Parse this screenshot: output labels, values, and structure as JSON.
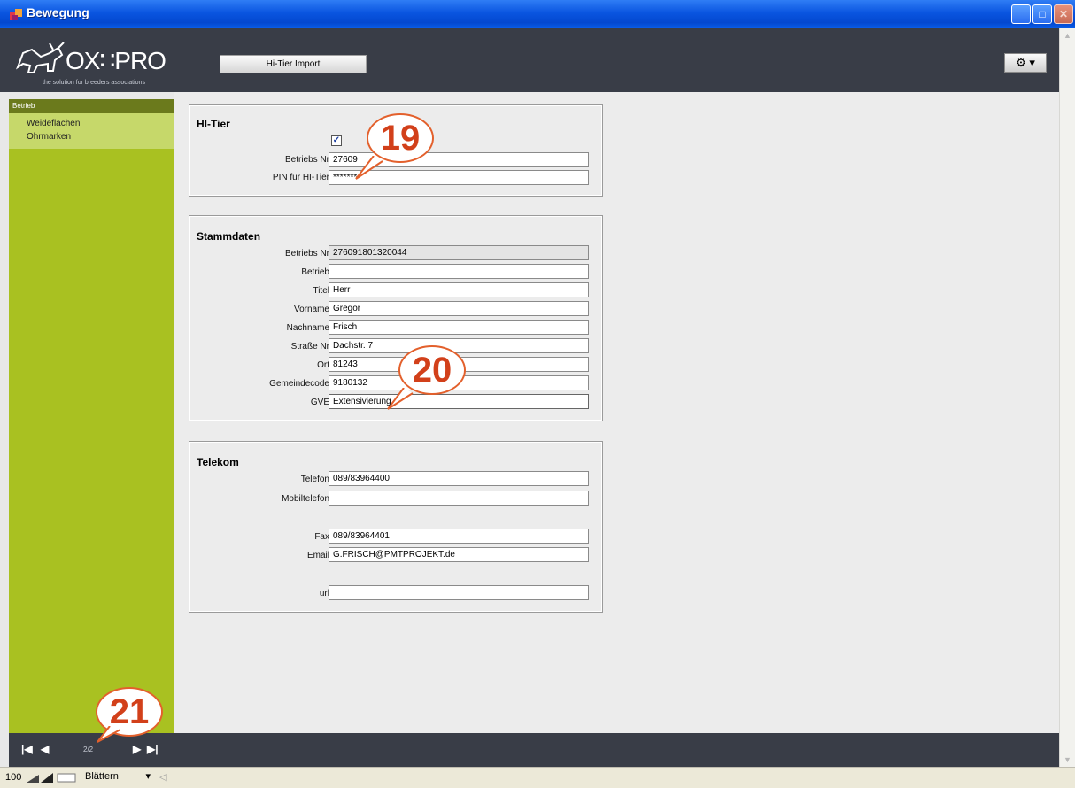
{
  "window": {
    "title": "Bewegung"
  },
  "header": {
    "logo_text": "OX∷PRO",
    "logo_sub": "the solution for breeders associations",
    "import_button": "Hi-Tier Import",
    "gear_label": "⚙ ▾"
  },
  "sidebar": {
    "header": "Betrieb",
    "items": [
      {
        "label": "Weideflächen"
      },
      {
        "label": "Ohrmarken"
      }
    ]
  },
  "hitier": {
    "title": "HI-Tier",
    "checkbox_checked": true,
    "fields": [
      {
        "label": "Betriebs Nr",
        "value": "27609"
      },
      {
        "label": "PIN für HI-Tier",
        "value": "*******"
      }
    ]
  },
  "stammdaten": {
    "title": "Stammdaten",
    "fields": [
      {
        "label": "Betriebs Nr",
        "value": "276091801320044"
      },
      {
        "label": "Betrieb",
        "value": ""
      },
      {
        "label": "Titel",
        "value": "Herr"
      },
      {
        "label": "Vorname",
        "value": "Gregor"
      },
      {
        "label": "Nachname",
        "value": "Frisch"
      },
      {
        "label": "Straße Nr",
        "value": "Dachstr. 7"
      },
      {
        "label": "Ort",
        "value": "81243"
      },
      {
        "label": "Gemeindecode",
        "value": "9180132"
      },
      {
        "label": "GVE",
        "value": "Extensivierung"
      }
    ]
  },
  "telekom": {
    "title": "Telekom",
    "fields": [
      {
        "label": "Telefon",
        "value": "089/83964400"
      },
      {
        "label": "Mobiltelefon",
        "value": ""
      },
      {
        "label": "Fax",
        "value": "089/83964401"
      },
      {
        "label": "Email",
        "value": "G.FRISCH@PMTPROJEKT.de"
      },
      {
        "label": "url",
        "value": ""
      }
    ]
  },
  "footer": {
    "page_indicator": "2/2"
  },
  "statusbar": {
    "zoom": "100",
    "mode": "Blättern"
  },
  "callouts": [
    "19",
    "20",
    "21"
  ]
}
